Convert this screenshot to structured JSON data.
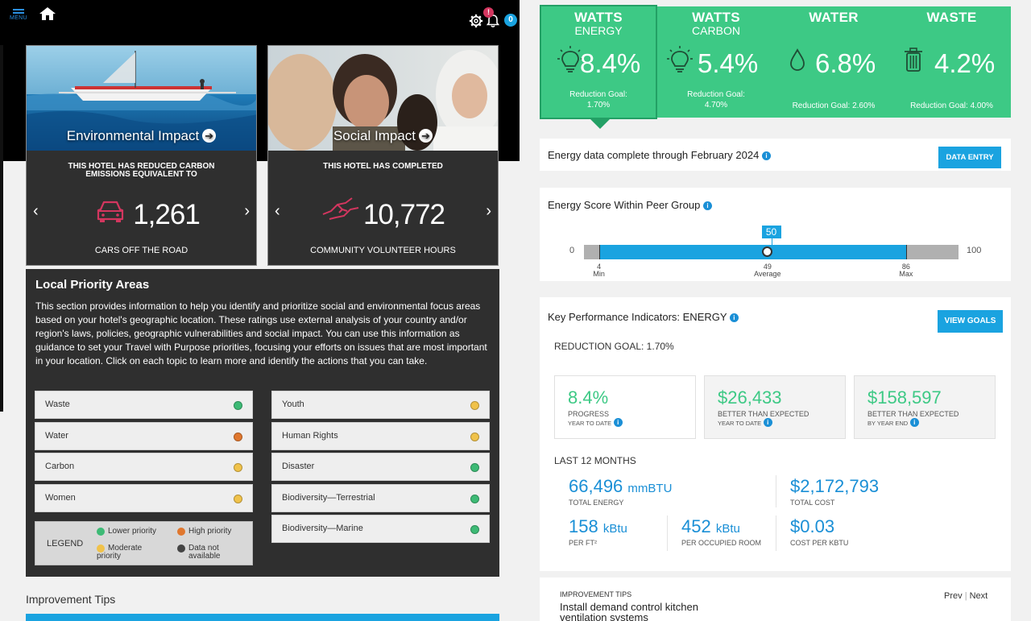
{
  "header": {
    "menu_label": "MENU",
    "notif_badge": "!",
    "cart_count": "0"
  },
  "cards": {
    "environmental": {
      "title": "Environmental Impact",
      "heading": "THIS HOTEL HAS REDUCED CARBON EMISSIONS EQUIVALENT TO",
      "value": "1,261",
      "caption": "CARS OFF THE ROAD",
      "icon": "car-icon"
    },
    "social": {
      "title": "Social Impact",
      "heading": "THIS HOTEL HAS COMPLETED",
      "value": "10,772",
      "caption": "COMMUNITY VOLUNTEER HOURS",
      "icon": "handshake-icon"
    },
    "nav_prev": "‹",
    "nav_next": "›"
  },
  "local_priority": {
    "title": "Local Priority Areas",
    "description": "This section provides information to help you identify and prioritize social and environmental focus areas based on your hotel's geographic location. These ratings use external analysis of your country and/or region's laws, policies, geographic vulnerabilities and social impact. You can use this information as guidance to set your Travel with Purpose priorities, focusing your efforts on issues that are most important in your location. Click on each topic to learn more and identify the actions that you can take.",
    "left_items": [
      {
        "label": "Waste",
        "status": "low"
      },
      {
        "label": "Water",
        "status": "high"
      },
      {
        "label": "Carbon",
        "status": "moderate"
      },
      {
        "label": "Women",
        "status": "moderate"
      }
    ],
    "right_items": [
      {
        "label": "Youth",
        "status": "moderate"
      },
      {
        "label": "Human Rights",
        "status": "moderate"
      },
      {
        "label": "Disaster",
        "status": "low"
      },
      {
        "label": "Biodiversity—Terrestrial",
        "status": "low"
      },
      {
        "label": "Biodiversity—Marine",
        "status": "low"
      }
    ],
    "legend": {
      "title": "LEGEND",
      "low": "Lower priority",
      "high": "High priority",
      "moderate_1": "Moderate",
      "moderate_2": "priority",
      "na_1": "Data not",
      "na_2": "available"
    },
    "colors": {
      "low": "#3dba75",
      "high": "#e0772e",
      "moderate": "#f0c24a",
      "na": "#444444"
    }
  },
  "improvement_tips_left": {
    "title": "Improvement Tips"
  },
  "metric_tabs": [
    {
      "title": "WATTS",
      "subtitle": "ENERGY",
      "value": "8.4%",
      "goal_label": "Reduction Goal:",
      "goal_value": "1.70%",
      "icon": "lightbulb-icon"
    },
    {
      "title": "WATTS",
      "subtitle": "CARBON",
      "value": "5.4%",
      "goal_label": "Reduction Goal:",
      "goal_value": "4.70%",
      "icon": "lightbulb-icon"
    },
    {
      "title": "WATER",
      "subtitle": "",
      "value": "6.8%",
      "goal_label": "Reduction Goal: 2.60%",
      "goal_value": "",
      "icon": "water-drop-icon"
    },
    {
      "title": "WASTE",
      "subtitle": "",
      "value": "4.2%",
      "goal_label": "Reduction Goal: 4.00%",
      "goal_value": "",
      "icon": "trash-icon"
    }
  ],
  "data_status": {
    "text": "Energy data complete through February 2024",
    "button": "DATA ENTRY"
  },
  "peer_score": {
    "title": "Energy Score Within Peer Group",
    "scale_min": "0",
    "scale_max": "100",
    "score": 50,
    "score_label": "50",
    "min": 4,
    "avg": 49,
    "max": 86,
    "min_value": "4",
    "min_label": "Min",
    "avg_value": "49",
    "avg_label": "Average",
    "max_value": "86",
    "max_label": "Max"
  },
  "kpi": {
    "title": "Key Performance Indicators: ENERGY",
    "button": "VIEW GOALS",
    "reduction_goal": "REDUCTION GOAL: 1.70%",
    "boxes": [
      {
        "value": "8.4%",
        "label": "PROGRESS",
        "sub": "YEAR TO DATE"
      },
      {
        "value": "$26,433",
        "label": "BETTER THAN EXPECTED",
        "sub": "YEAR TO DATE"
      },
      {
        "value": "$158,597",
        "label": "BETTER THAN EXPECTED",
        "sub": "BY YEAR END"
      }
    ],
    "last12_title": "LAST 12 MONTHS",
    "total_energy": {
      "value": "66,496",
      "unit": "mmBTU",
      "label": "TOTAL ENERGY"
    },
    "total_cost": {
      "value": "$2,172,793",
      "label": "TOTAL COST"
    },
    "per_ft": {
      "value": "158",
      "unit": "kBtu",
      "label": "PER FT²"
    },
    "per_room": {
      "value": "452",
      "unit": "kBtu",
      "label": "PER OCCUPIED ROOM"
    },
    "per_kbtu": {
      "value": "$0.03",
      "label": "COST PER KBTU"
    }
  },
  "improvement_tips_right": {
    "title": "IMPROVEMENT TIPS",
    "tip": "Install demand control kitchen ventilation systems",
    "prev": "Prev",
    "separator": "|",
    "next": "Next"
  }
}
